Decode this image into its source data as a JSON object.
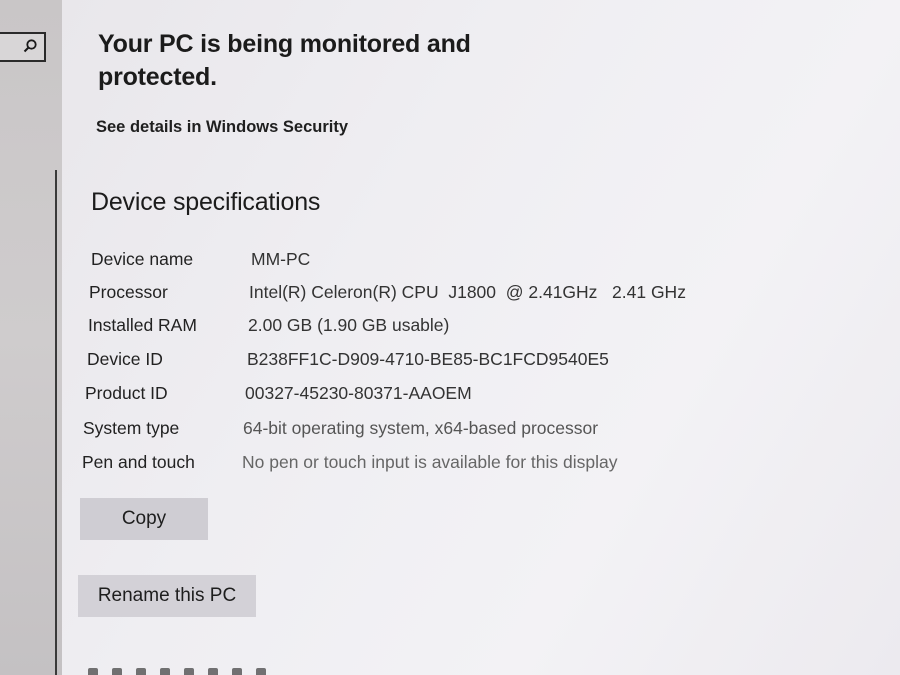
{
  "security": {
    "headline": "Your PC is being monitored and protected.",
    "details_link": "See details in Windows Security"
  },
  "device_specifications": {
    "title": "Device specifications",
    "rows": [
      {
        "label": "Device name",
        "value": "MM-PC"
      },
      {
        "label": "Processor",
        "value": "Intel(R) Celeron(R) CPU  J1800  @ 2.41GHz   2.41 GHz"
      },
      {
        "label": "Installed RAM",
        "value": "2.00 GB (1.90 GB usable)"
      },
      {
        "label": "Device ID",
        "value": "B238FF1C-D909-4710-BE85-BC1FCD9540E5"
      },
      {
        "label": "Product ID",
        "value": "00327-45230-80371-AAOEM"
      },
      {
        "label": "System type",
        "value": "64-bit operating system, x64-based processor"
      },
      {
        "label": "Pen and touch",
        "value": "No pen or touch input is available for this display"
      }
    ]
  },
  "buttons": {
    "copy": "Copy",
    "rename": "Rename this PC"
  },
  "icons": {
    "search": "search-icon"
  },
  "colors": {
    "background": "#efeef2",
    "sidebar": "#cbc8c9",
    "button": "#cfcdd3",
    "text": "#1b1b1b"
  }
}
